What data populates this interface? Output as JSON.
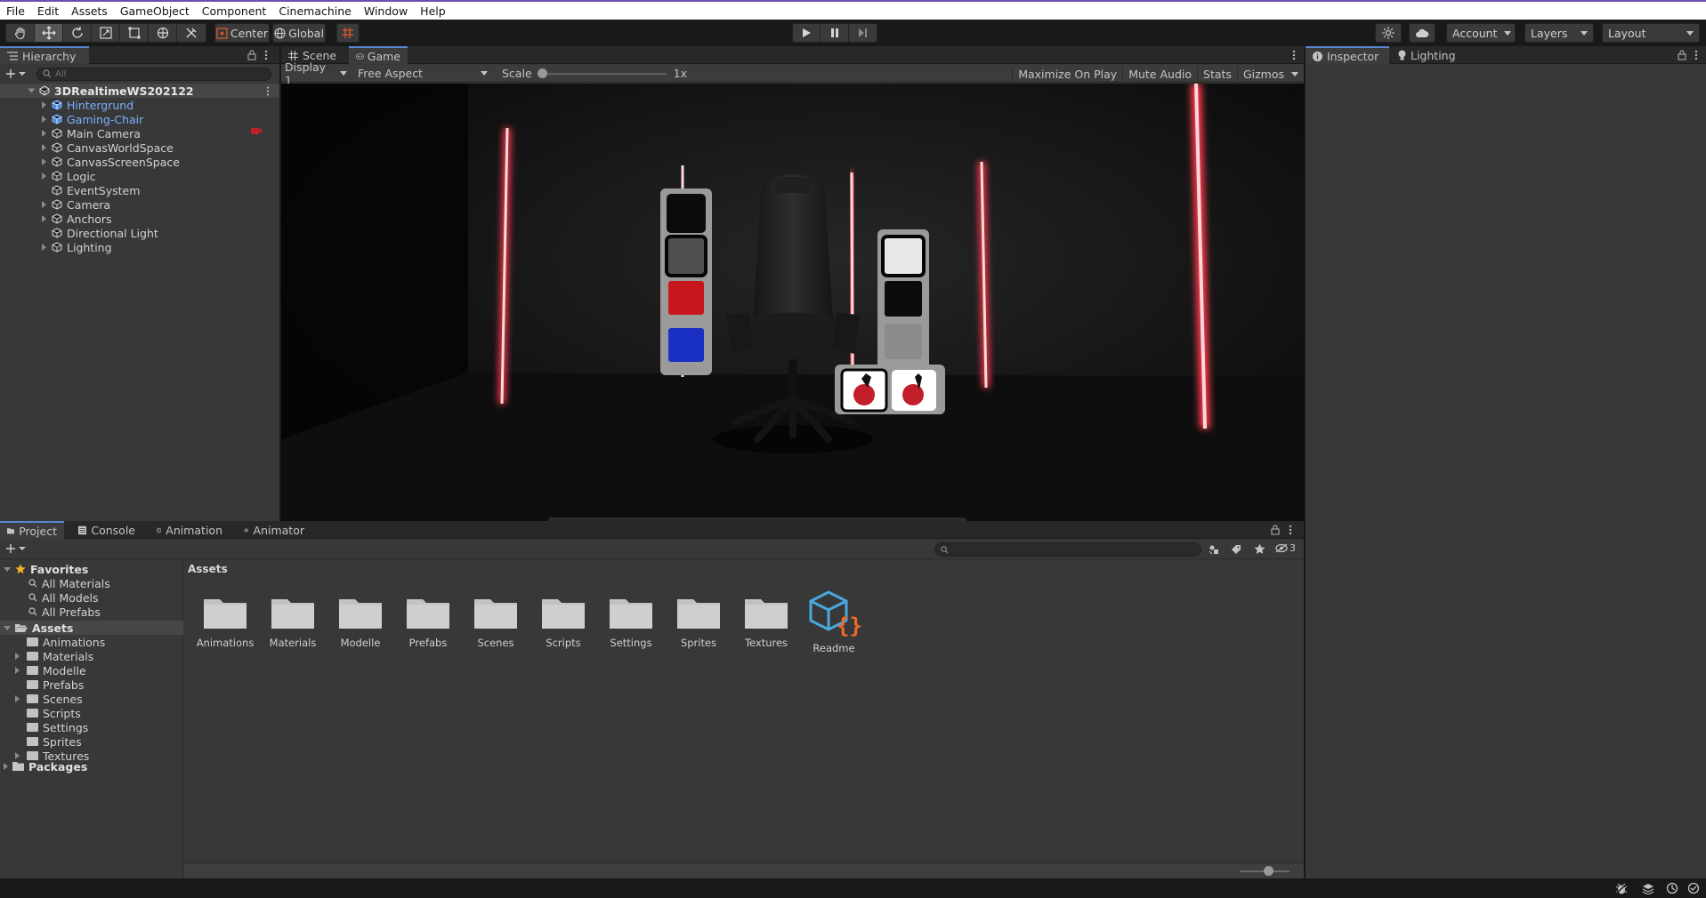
{
  "menu": [
    "File",
    "Edit",
    "Assets",
    "GameObject",
    "Component",
    "Cinemachine",
    "Window",
    "Help"
  ],
  "toolbar": {
    "tools": [
      "hand-icon",
      "move-icon",
      "rotate-icon",
      "scale-icon",
      "rect-icon",
      "transform-icon",
      "custom-tool-icon"
    ],
    "pivot_label": "Center",
    "space_label": "Global",
    "account_label": "Account",
    "layers_label": "Layers",
    "layout_label": "Layout"
  },
  "hierarchy": {
    "tab_label": "Hierarchy",
    "search_placeholder": "All",
    "scene_name": "3DRealtimeWS202122",
    "items": [
      {
        "label": "Hintergrund",
        "prefab": true,
        "expandable": true
      },
      {
        "label": "Gaming-Chair",
        "prefab": true,
        "expandable": true
      },
      {
        "label": "Main Camera",
        "prefab": false,
        "expandable": true
      },
      {
        "label": "CanvasWorldSpace",
        "prefab": false,
        "expandable": true
      },
      {
        "label": "CanvasScreenSpace",
        "prefab": false,
        "expandable": true
      },
      {
        "label": "Logic",
        "prefab": false,
        "expandable": true
      },
      {
        "label": "EventSystem",
        "prefab": false,
        "expandable": false
      },
      {
        "label": "Camera",
        "prefab": false,
        "expandable": true
      },
      {
        "label": "Anchors",
        "prefab": false,
        "expandable": true
      },
      {
        "label": "Directional Light",
        "prefab": false,
        "expandable": false
      },
      {
        "label": "Lighting",
        "prefab": false,
        "expandable": true
      }
    ]
  },
  "gameview": {
    "tabs": [
      "Scene",
      "Game"
    ],
    "display_label": "Display 1",
    "aspect_label": "Free Aspect",
    "scale_label": "Scale",
    "scale_value": "1x",
    "scale_fraction": 0.0,
    "options": [
      "Maximize On Play",
      "Mute Audio",
      "Stats",
      "Gizmos"
    ],
    "left_swatches": [
      "#0b0b0b",
      "#4f4f4f",
      "#c8161d",
      "#1a2fc4"
    ],
    "right_swatches": [
      "#e8e8e8",
      "#0b0b0b",
      "#8c8c8c"
    ],
    "accent_glow": "#ff3a4e"
  },
  "inspector": {
    "tabs": [
      "Inspector",
      "Lighting"
    ]
  },
  "project": {
    "tabs": [
      "Project",
      "Console",
      "Animation",
      "Animator"
    ],
    "search_placeholder": "",
    "hidden_count": "3",
    "favorites_label": "Favorites",
    "favorites": [
      "All Materials",
      "All Models",
      "All Prefabs"
    ],
    "assets_label": "Assets",
    "asset_tree": [
      {
        "label": "Animations",
        "expandable": false
      },
      {
        "label": "Materials",
        "expandable": true
      },
      {
        "label": "Modelle",
        "expandable": true
      },
      {
        "label": "Prefabs",
        "expandable": false
      },
      {
        "label": "Scenes",
        "expandable": true
      },
      {
        "label": "Scripts",
        "expandable": false
      },
      {
        "label": "Settings",
        "expandable": false
      },
      {
        "label": "Sprites",
        "expandable": false
      },
      {
        "label": "Textures",
        "expandable": true
      }
    ],
    "packages_label": "Packages",
    "breadcrumb": "Assets",
    "grid": [
      "Animations",
      "Materials",
      "Modelle",
      "Prefabs",
      "Scenes",
      "Scripts",
      "Settings",
      "Sprites",
      "Textures",
      "Readme"
    ]
  }
}
